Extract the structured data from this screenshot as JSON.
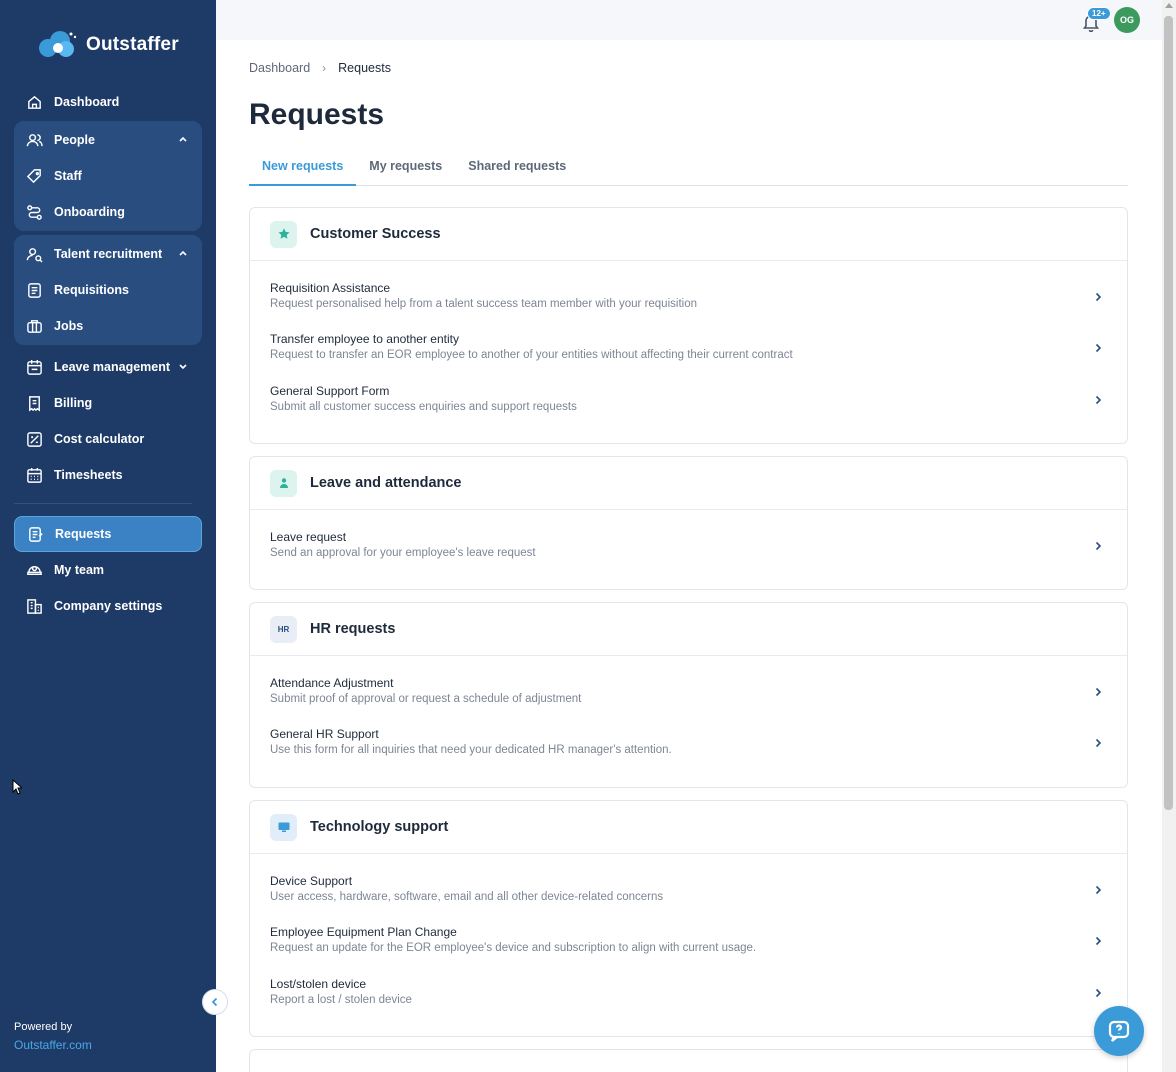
{
  "brand": {
    "name": "Outstaffer"
  },
  "sidebar": {
    "items": [
      {
        "label": "Dashboard",
        "icon": "home-icon"
      },
      {
        "label": "People",
        "icon": "people-icon"
      },
      {
        "label": "Staff",
        "icon": "tag-icon"
      },
      {
        "label": "Onboarding",
        "icon": "route-icon"
      },
      {
        "label": "Talent recruitment",
        "icon": "user-search-icon"
      },
      {
        "label": "Requisitions",
        "icon": "document-icon"
      },
      {
        "label": "Jobs",
        "icon": "briefcase-icon"
      },
      {
        "label": "Leave management",
        "icon": "calendar-icon"
      },
      {
        "label": "Billing",
        "icon": "receipt-icon"
      },
      {
        "label": "Cost calculator",
        "icon": "calculator-icon"
      },
      {
        "label": "Timesheets",
        "icon": "timesheet-icon"
      },
      {
        "label": "Requests",
        "icon": "request-icon"
      },
      {
        "label": "My team",
        "icon": "team-icon"
      },
      {
        "label": "Company settings",
        "icon": "building-icon"
      }
    ],
    "powered_by": "Powered by",
    "powered_link": "Outstaffer.com"
  },
  "topbar": {
    "notification_count": "12+",
    "avatar_initials": "OG"
  },
  "breadcrumb": {
    "home": "Dashboard",
    "current": "Requests"
  },
  "page": {
    "title": "Requests"
  },
  "tabs": [
    {
      "label": "New requests"
    },
    {
      "label": "My requests"
    },
    {
      "label": "Shared requests"
    }
  ],
  "cards": [
    {
      "title": "Customer Success",
      "icon": "star-icon",
      "items": [
        {
          "title": "Requisition Assistance",
          "desc": "Request personalised help from a talent success team member with your requisition"
        },
        {
          "title": "Transfer employee to another entity",
          "desc": "Request to transfer an EOR employee to another of your entities without affecting their current contract"
        },
        {
          "title": "General Support Form",
          "desc": "Submit all customer success enquiries and support requests"
        }
      ]
    },
    {
      "title": "Leave and attendance",
      "icon": "person-icon",
      "items": [
        {
          "title": "Leave request",
          "desc": "Send an approval for your employee's leave request"
        }
      ]
    },
    {
      "title": "HR requests",
      "icon_text": "HR",
      "items": [
        {
          "title": "Attendance Adjustment",
          "desc": "Submit proof of approval or request a schedule of adjustment"
        },
        {
          "title": "General HR Support",
          "desc": "Use this form for all inquiries that need your dedicated HR manager's attention."
        }
      ]
    },
    {
      "title": "Technology support",
      "icon": "monitor-icon",
      "items": [
        {
          "title": "Device Support",
          "desc": "User access, hardware, software, email and all other device-related concerns"
        },
        {
          "title": "Employee Equipment Plan Change",
          "desc": "Request an update for the EOR employee's device and subscription to align with current usage."
        },
        {
          "title": "Lost/stolen device",
          "desc": "Report a lost / stolen device"
        }
      ]
    }
  ],
  "colors": {
    "sidebar": "#1e3a66",
    "accent": "#3a9bd8",
    "active_nav": "#3b82c4"
  }
}
